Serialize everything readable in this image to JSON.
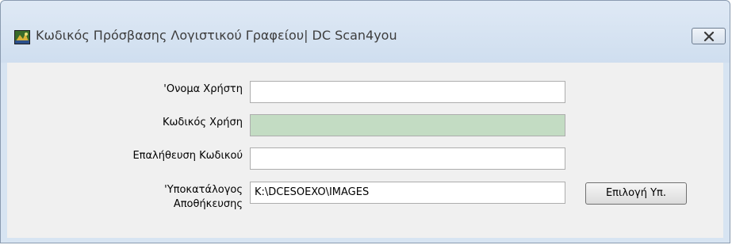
{
  "window": {
    "title": "Κωδικός Πρόσβασης Λογιστικού Γραφείου| DC Scan4you"
  },
  "form": {
    "username": {
      "label": "'Ονομα Χρήστη",
      "value": ""
    },
    "password": {
      "label": "Κωδικός Χρήση",
      "value": ""
    },
    "password_confirm": {
      "label": "Επαλήθευση Κωδικού",
      "value": ""
    },
    "storage_dir": {
      "label_line1": "'Υποκατάλογος",
      "label_line2": "Αποθήκευσης",
      "value": "K:\\DCESOEXO\\IMAGES"
    },
    "select_dir_button": "Επιλογή Υπ."
  },
  "colors": {
    "titlebar": "#d7e4f2",
    "client_bg": "#f0f0f0",
    "password_field_bg": "#c3dcc3"
  },
  "icons": {
    "app": "app-icon",
    "close": "close-icon"
  }
}
